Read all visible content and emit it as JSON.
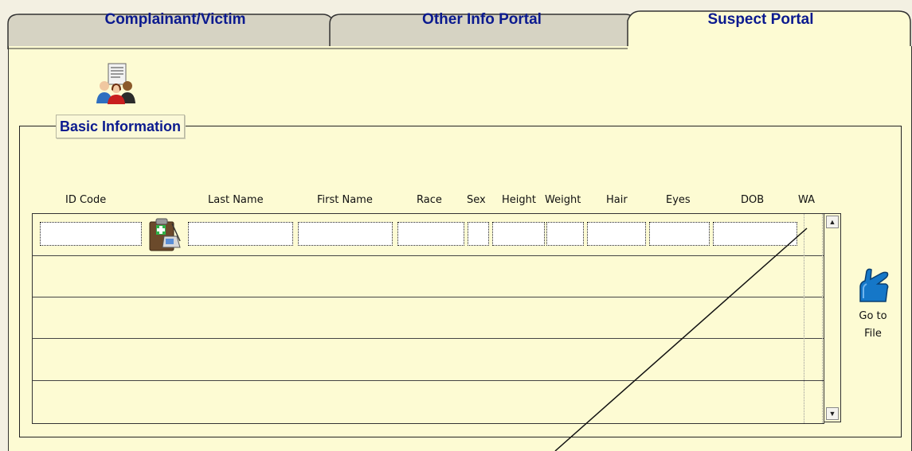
{
  "tabs": [
    {
      "label": "Complainant/Victim",
      "active": false
    },
    {
      "label": "Other Info Portal",
      "active": false
    },
    {
      "label": "Suspect Portal",
      "active": true
    }
  ],
  "section": {
    "title": "Basic Information"
  },
  "columns": [
    "ID Code",
    "Last Name",
    "First Name",
    "Race",
    "Sex",
    "Height",
    "Weight",
    "Hair",
    "Eyes",
    "DOB",
    "WA"
  ],
  "grid": {
    "visible_rows": 5
  },
  "go_to_file": {
    "label": "Go to File"
  },
  "icons": {
    "tab_icon": "people-document-icon",
    "row_icon": "medical-clipboard-icon",
    "go_to_file_icon": "pointing-hand-icon",
    "scroll_up": "arrow-up-icon",
    "scroll_down": "arrow-down-icon"
  },
  "colors": {
    "tab_text": "#0b1a8f",
    "panel_background": "#fdfbd3",
    "inactive_tab": "#d6d3c3"
  }
}
